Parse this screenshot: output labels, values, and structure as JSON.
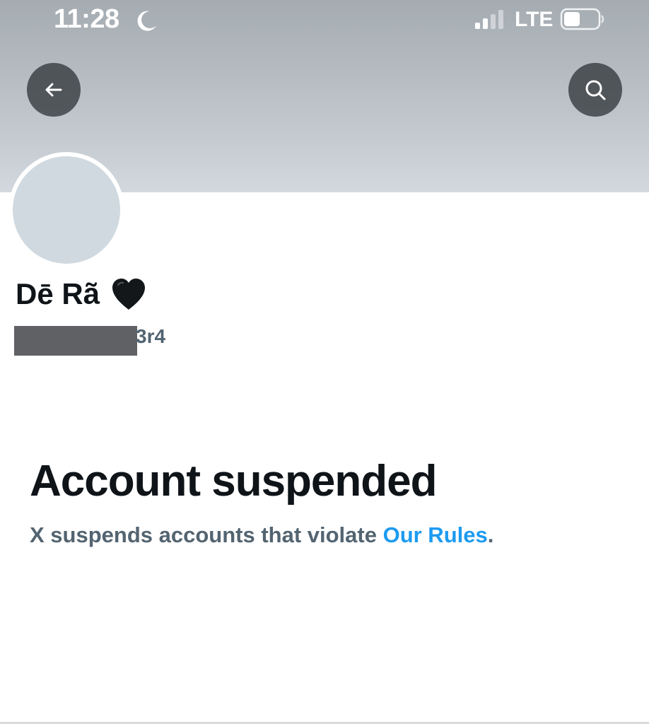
{
  "status_bar": {
    "time": "11:28",
    "network": "LTE",
    "signal_bars": 2,
    "signal_bars_total": 4,
    "battery_level": 0.45,
    "icons": [
      "moon-icon",
      "signal-icon",
      "battery-icon"
    ]
  },
  "header": {
    "back_icon": "arrow-left-icon",
    "search_icon": "search-icon",
    "banner_color": "#b5bcc2"
  },
  "profile": {
    "display_name": "Dē Rã",
    "name_emoji": "black-heart-icon",
    "handle_visible_suffix": "3r4",
    "avatar_color": "#cfd9df"
  },
  "notice": {
    "title": "Account suspended",
    "body_prefix": "X suspends accounts that violate ",
    "link_text": "Our Rules",
    "body_suffix": "."
  },
  "colors": {
    "primary_text": "#0f1419",
    "secondary_text": "#536471",
    "link": "#1d9bf0"
  }
}
